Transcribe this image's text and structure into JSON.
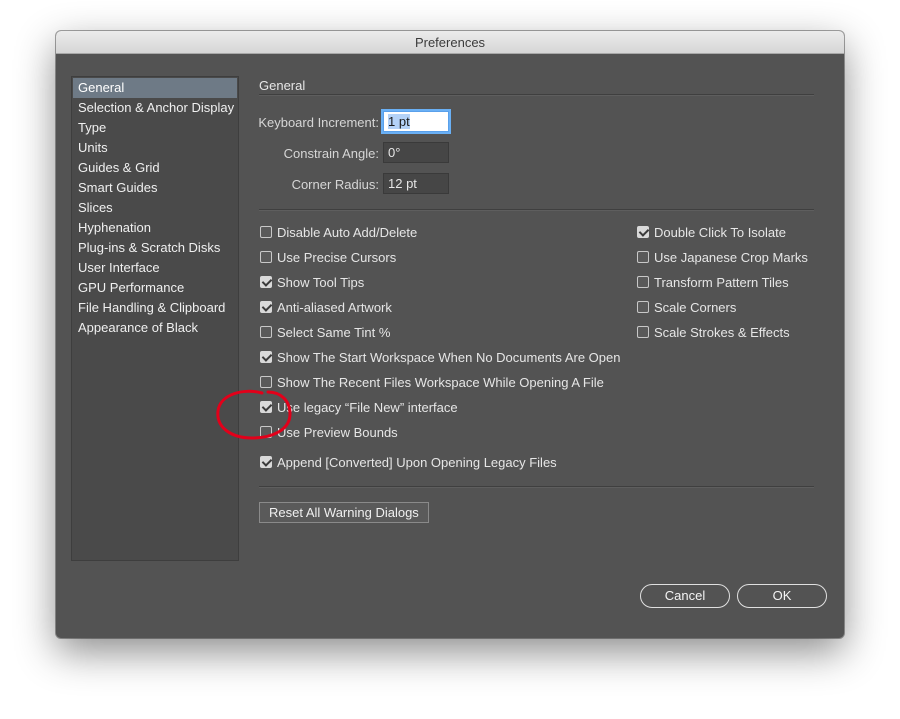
{
  "window": {
    "title": "Preferences"
  },
  "sidebar": {
    "items": [
      {
        "label": "General",
        "selected": true
      },
      {
        "label": "Selection & Anchor Display"
      },
      {
        "label": "Type"
      },
      {
        "label": "Units"
      },
      {
        "label": "Guides & Grid"
      },
      {
        "label": "Smart Guides"
      },
      {
        "label": "Slices"
      },
      {
        "label": "Hyphenation"
      },
      {
        "label": "Plug-ins & Scratch Disks"
      },
      {
        "label": "User Interface"
      },
      {
        "label": "GPU Performance"
      },
      {
        "label": "File Handling & Clipboard"
      },
      {
        "label": "Appearance of Black"
      }
    ]
  },
  "general": {
    "title": "General",
    "fields": [
      {
        "label": "Keyboard Increment:",
        "value": "1 pt",
        "focused": true
      },
      {
        "label": "Constrain Angle:",
        "value": "0°"
      },
      {
        "label": "Corner Radius:",
        "value": "12 pt"
      }
    ],
    "left_options": [
      {
        "label": "Disable Auto Add/Delete",
        "checked": false
      },
      {
        "label": "Use Precise Cursors",
        "checked": false
      },
      {
        "label": "Show Tool Tips",
        "checked": true
      },
      {
        "label": "Anti-aliased Artwork",
        "checked": true
      },
      {
        "label": "Select Same Tint %",
        "checked": false
      },
      {
        "label": "Show The Start Workspace When No Documents Are Open",
        "checked": true
      },
      {
        "label": "Show The Recent Files Workspace While Opening A File",
        "checked": false
      },
      {
        "label": "Use legacy “File New” interface",
        "checked": true
      },
      {
        "label": "Use Preview Bounds",
        "checked": false
      },
      {
        "label": "Append [Converted] Upon Opening Legacy Files",
        "checked": true
      }
    ],
    "right_options": [
      {
        "label": "Double Click To Isolate",
        "checked": true
      },
      {
        "label": "Use Japanese Crop Marks",
        "checked": false
      },
      {
        "label": "Transform Pattern Tiles",
        "checked": false
      },
      {
        "label": "Scale Corners",
        "checked": false
      },
      {
        "label": "Scale Strokes & Effects",
        "checked": false
      }
    ],
    "reset_label": "Reset All Warning Dialogs"
  },
  "buttons": {
    "cancel": "Cancel",
    "ok": "OK"
  },
  "colors": {
    "window_bg": "#535353",
    "sidebar_bg": "#4a4a4a",
    "selection": "#6e7a86",
    "focus_ring": "#6ab0f5",
    "annotation": "#e2001a"
  },
  "icons": {
    "checkbox": "checkbox-icon",
    "checkmark": "checkmark-icon",
    "annotation": "red-circle-annotation"
  }
}
